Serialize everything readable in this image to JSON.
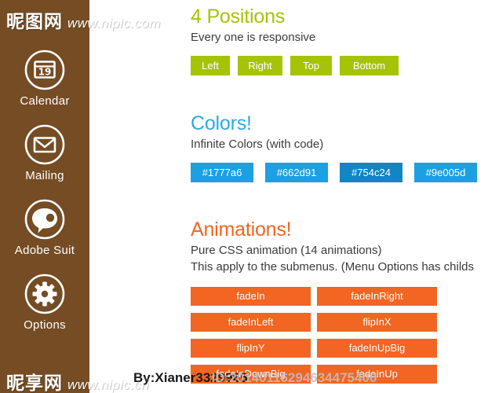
{
  "colors": {
    "sidebar_bg": "#754c24",
    "green": "#a6c307",
    "blue": "#1ba1e2",
    "blue_dark": "#1285c4",
    "orange": "#f26522",
    "cyan_heading": "#29abe2",
    "page_bg": "#ffffff",
    "text": "#3b3b3b"
  },
  "sidebar": {
    "items": [
      {
        "label": "Calendar",
        "icon": "calendar-icon",
        "badge": "19"
      },
      {
        "label": "Mailing",
        "icon": "envelope-icon"
      },
      {
        "label": "Adobe Suit",
        "icon": "photoshop-bubble-icon"
      },
      {
        "label": "Options",
        "icon": "gear-icon"
      }
    ]
  },
  "sections": {
    "positions": {
      "title": "4 Positions",
      "subtitle": "Every one is responsive",
      "buttons": [
        "Left",
        "Right",
        "Top",
        "Bottom"
      ]
    },
    "colors": {
      "title": "Colors!",
      "subtitle": "Infinite Colors (with code)",
      "buttons": [
        "#1777a6",
        "#662d91",
        "#754c24",
        "#9e005d"
      ]
    },
    "animations": {
      "title": "Animations!",
      "subtitle_line1": "Pure CSS animation (14 animations)",
      "subtitle_line2": "This apply to the submenus. (Menu Options has childs",
      "buttons": [
        "fadeIn",
        "fadeInRight",
        "fadeInLeft",
        "flipInX",
        "flipInY",
        "fadeInUpBig",
        "fadeInDownBig",
        "fadeInUp"
      ]
    }
  },
  "watermarks": {
    "top_cn": "昵图网",
    "top_url": "www.nipic.com",
    "bottom_cn": "昵享网",
    "bottom_url": "www.nipic.cn",
    "author": "By:Xianer3329965",
    "id": "ID:20140116294634475400"
  }
}
